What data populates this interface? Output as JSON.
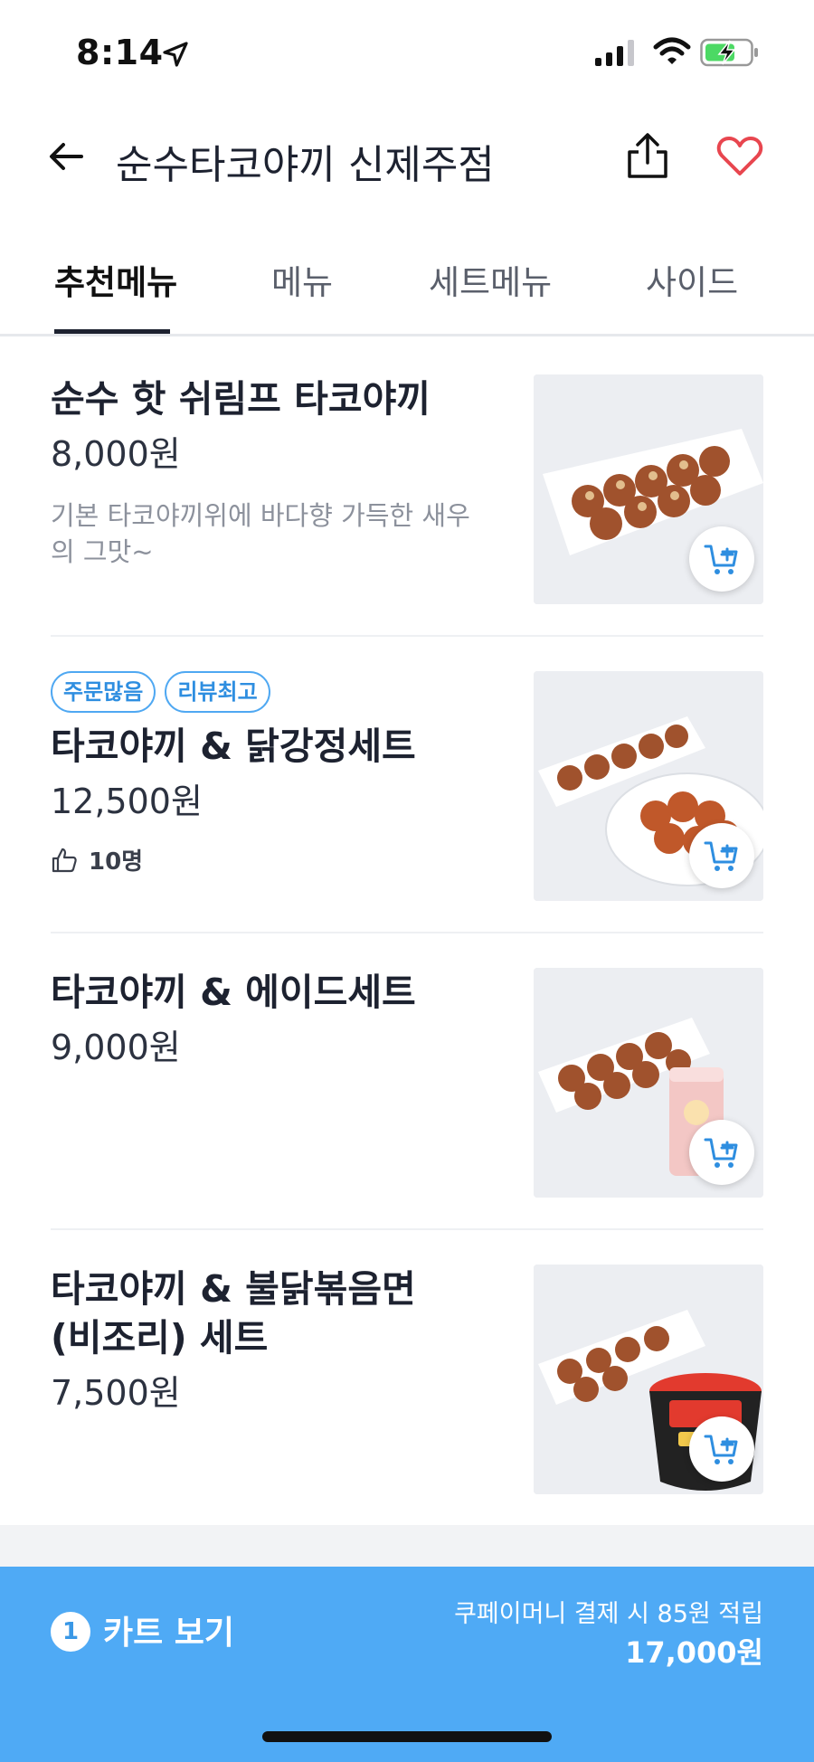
{
  "status_bar": {
    "time": "8:14"
  },
  "header": {
    "title": "순수타코야끼 신제주점"
  },
  "tabs": [
    {
      "label": "추천메뉴",
      "active": true
    },
    {
      "label": "메뉴",
      "active": false
    },
    {
      "label": "세트메뉴",
      "active": false
    },
    {
      "label": "사이드",
      "active": false
    }
  ],
  "menu": [
    {
      "name": "순수 핫 쉬림프 타코야끼",
      "price": "8,000원",
      "description": "기본 타코야끼위에 바다향 가득한 새우의 그맛~"
    },
    {
      "badges": [
        "주문많음",
        "리뷰최고"
      ],
      "name": "타코야끼 & 닭강정세트",
      "price": "12,500원",
      "likes": "10명"
    },
    {
      "name": "타코야끼 & 에이드세트",
      "price": "9,000원"
    },
    {
      "name": "타코야끼 & 불닭볶음면 (비조리) 세트",
      "price": "7,500원"
    }
  ],
  "cart": {
    "count": "1",
    "label": "카트 보기",
    "note": "쿠페이머니 결제 시 85원 적립",
    "total": "17,000원"
  },
  "colors": {
    "accent": "#4faaf5",
    "heart": "#e8464f",
    "badge": "#4fa8f2"
  }
}
